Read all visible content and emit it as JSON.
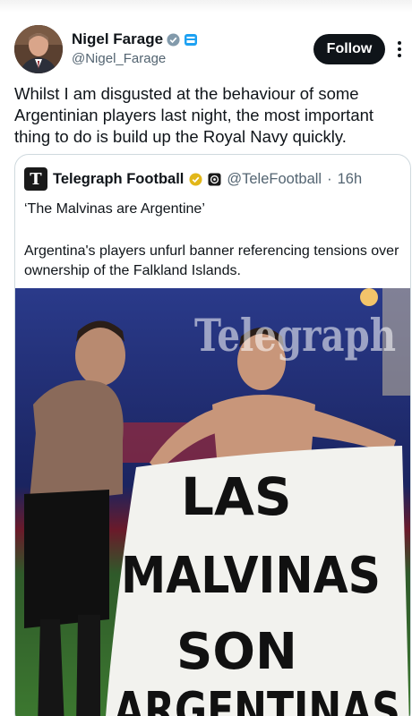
{
  "author": {
    "display_name": "Nigel Farage",
    "handle": "@Nigel_Farage"
  },
  "follow_label": "Follow",
  "tweet_text": "Whilst I am disgusted at the behaviour of some Argentinian players last night, the most important thing to do is build up the Royal Navy quickly.",
  "quoted": {
    "logo_glyph": "T",
    "display_name": "Telegraph Football",
    "handle": "@TeleFootball",
    "separator": "·",
    "time": "16h",
    "headline": "‘The Malvinas are Argentine’",
    "body": "Argentina's players unfurl banner referencing tensions over ownership of the Falkland Islands.",
    "image": {
      "watermark": "Telegraph",
      "banner_lines": [
        "LAS",
        "MALVINAS",
        "SON",
        "ARGENTINAS"
      ]
    }
  },
  "colors": {
    "verified_gray": "#829aab",
    "verified_gold": "#e2b719",
    "follow_bg": "#0f1419",
    "secondary_text": "#536471",
    "border": "#cfd9de"
  }
}
